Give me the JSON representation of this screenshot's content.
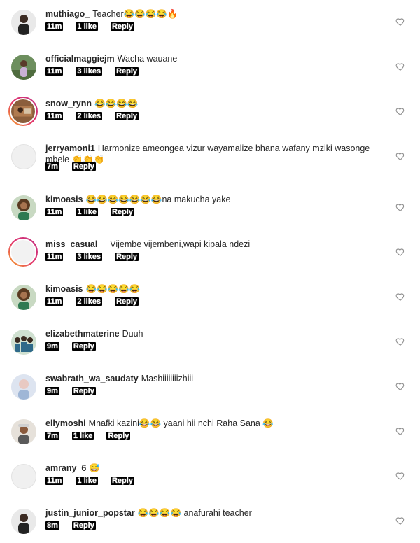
{
  "comments": [
    {
      "username": "muthiago_",
      "text": "Teacher😂😂😂😂🔥",
      "time": "11m",
      "likes": "1 like",
      "reply": "Reply",
      "avatar": "person-dark"
    },
    {
      "username": "officialmaggiejm",
      "text": "Wacha wauane",
      "time": "11m",
      "likes": "3 likes",
      "reply": "Reply",
      "avatar": "person-field"
    },
    {
      "username": "snow_rynn",
      "text": "😂😂😂😂",
      "time": "11m",
      "likes": "2 likes",
      "reply": "Reply",
      "avatar": "story-ring-photo"
    },
    {
      "username": "jerryamoni1",
      "text": "Harmonize ameongea vizur wayamalize bhana wafany mziki wasonge mbele 👏👏👏",
      "time": "7m",
      "likes": "",
      "reply": "Reply",
      "avatar": "blank"
    },
    {
      "username": "kimoasis",
      "text": "😂😂😂😂😂😂😂na makucha yake",
      "time": "11m",
      "likes": "1 like",
      "reply": "Reply",
      "avatar": "person-curly"
    },
    {
      "username": "miss_casual__",
      "text": "Vijembe vijembeni,wapi kipala ndezi",
      "time": "11m",
      "likes": "3 likes",
      "reply": "Reply",
      "avatar": "story-ring-blank"
    },
    {
      "username": "kimoasis",
      "text": "😂😂😂😂😂",
      "time": "11m",
      "likes": "2 likes",
      "reply": "Reply",
      "avatar": "person-curly"
    },
    {
      "username": "elizabethmaterine",
      "text": "Duuh",
      "time": "9m",
      "likes": "",
      "reply": "Reply",
      "avatar": "group-photo"
    },
    {
      "username": "swabrath_wa_saudaty",
      "text": "Mashiiiiiiiizhiii",
      "time": "9m",
      "likes": "",
      "reply": "Reply",
      "avatar": "person-light"
    },
    {
      "username": "ellymoshi",
      "text": "Mnafki kazini😂😂 yaani hii nchi Raha Sana 😂",
      "time": "7m",
      "likes": "1 like",
      "reply": "Reply",
      "avatar": "person-hat"
    },
    {
      "username": "amrany_6",
      "text": "😅",
      "time": "11m",
      "likes": "1 like",
      "reply": "Reply",
      "avatar": "blank"
    },
    {
      "username": "justin_junior_popstar",
      "text": "😂😂😂😂 anafurahi teacher",
      "time": "8m",
      "likes": "",
      "reply": "Reply",
      "avatar": "person-dark"
    }
  ]
}
